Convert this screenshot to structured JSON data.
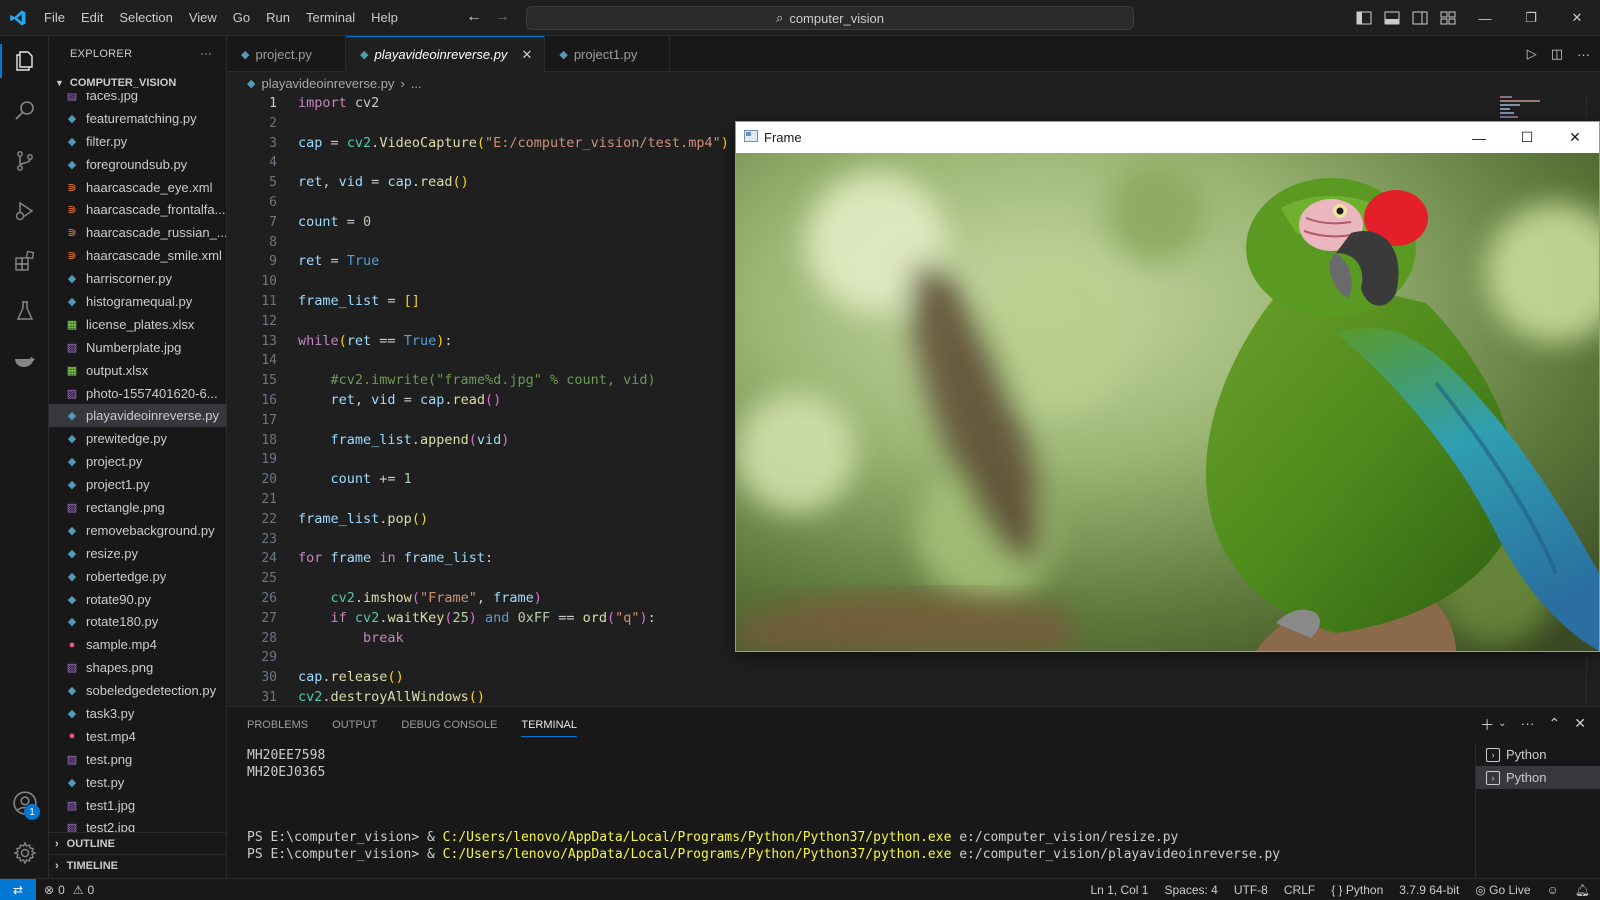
{
  "menu": [
    "File",
    "Edit",
    "Selection",
    "View",
    "Go",
    "Run",
    "Terminal",
    "Help"
  ],
  "search": {
    "text": "computer_vision"
  },
  "sidebar": {
    "title": "EXPLORER",
    "more": "···",
    "folder": "COMPUTER_VISION",
    "files": [
      {
        "name": "faces.jpg",
        "type": "img"
      },
      {
        "name": "featurematching.py",
        "type": "py"
      },
      {
        "name": "filter.py",
        "type": "py"
      },
      {
        "name": "foregroundsub.py",
        "type": "py"
      },
      {
        "name": "haarcascade_eye.xml",
        "type": "xml"
      },
      {
        "name": "haarcascade_frontalfa...",
        "type": "xml"
      },
      {
        "name": "haarcascade_russian_...",
        "type": "xml"
      },
      {
        "name": "haarcascade_smile.xml",
        "type": "xml"
      },
      {
        "name": "harriscorner.py",
        "type": "py"
      },
      {
        "name": "histogramequal.py",
        "type": "py"
      },
      {
        "name": "license_plates.xlsx",
        "type": "xlsx"
      },
      {
        "name": "Numberplate.jpg",
        "type": "img"
      },
      {
        "name": "output.xlsx",
        "type": "xlsx"
      },
      {
        "name": "photo-1557401620-6...",
        "type": "img"
      },
      {
        "name": "playavideoinreverse.py",
        "type": "py",
        "selected": true
      },
      {
        "name": "prewitedge.py",
        "type": "py"
      },
      {
        "name": "project.py",
        "type": "py"
      },
      {
        "name": "project1.py",
        "type": "py"
      },
      {
        "name": "rectangle.png",
        "type": "img"
      },
      {
        "name": "removebackground.py",
        "type": "py"
      },
      {
        "name": "resize.py",
        "type": "py"
      },
      {
        "name": "robertedge.py",
        "type": "py"
      },
      {
        "name": "rotate90.py",
        "type": "py"
      },
      {
        "name": "rotate180.py",
        "type": "py"
      },
      {
        "name": "sample.mp4",
        "type": "mp4"
      },
      {
        "name": "shapes.png",
        "type": "img"
      },
      {
        "name": "sobeledgedetection.py",
        "type": "py"
      },
      {
        "name": "task3.py",
        "type": "py"
      },
      {
        "name": "test.mp4",
        "type": "mp4"
      },
      {
        "name": "test.png",
        "type": "img"
      },
      {
        "name": "test.py",
        "type": "py"
      },
      {
        "name": "test1.jpg",
        "type": "img"
      },
      {
        "name": "test2.jpg",
        "type": "img"
      }
    ],
    "outline": "OUTLINE",
    "timeline": "TIMELINE"
  },
  "tabs": [
    {
      "label": "project.py",
      "active": false
    },
    {
      "label": "playavideoinreverse.py",
      "active": true
    },
    {
      "label": "project1.py",
      "active": false
    }
  ],
  "breadcrumb": {
    "file": "playavideoinreverse.py",
    "rest": "..."
  },
  "editor": {
    "current_line": 1,
    "lines": [
      [
        [
          "kw",
          "import"
        ],
        [
          "t",
          " cv2"
        ]
      ],
      [],
      [
        [
          "var",
          "cap"
        ],
        [
          "t",
          " = "
        ],
        [
          "mod",
          "cv2"
        ],
        [
          "t",
          "."
        ],
        [
          "fn",
          "VideoCapture"
        ],
        [
          "br",
          "("
        ],
        [
          "str",
          "\"E:/computer_vision/test.mp4\""
        ],
        [
          "br",
          ")"
        ]
      ],
      [],
      [
        [
          "var",
          "ret"
        ],
        [
          "t",
          ", "
        ],
        [
          "var",
          "vid"
        ],
        [
          "t",
          " = "
        ],
        [
          "var",
          "cap"
        ],
        [
          "t",
          "."
        ],
        [
          "fn",
          "read"
        ],
        [
          "br",
          "()"
        ]
      ],
      [],
      [
        [
          "var",
          "count"
        ],
        [
          "t",
          " = "
        ],
        [
          "num",
          "0"
        ]
      ],
      [],
      [
        [
          "var",
          "ret"
        ],
        [
          "t",
          " = "
        ],
        [
          "kw2",
          "True"
        ]
      ],
      [],
      [
        [
          "var",
          "frame_list"
        ],
        [
          "t",
          " = "
        ],
        [
          "br",
          "[]"
        ]
      ],
      [],
      [
        [
          "kw",
          "while"
        ],
        [
          "br",
          "("
        ],
        [
          "var",
          "ret"
        ],
        [
          "t",
          " == "
        ],
        [
          "kw2",
          "True"
        ],
        [
          "br",
          ")"
        ],
        [
          "t",
          ":"
        ]
      ],
      [],
      [
        [
          "t",
          "    "
        ],
        [
          "cmt",
          "#cv2.imwrite(\"frame%d.jpg\" % count, vid)"
        ]
      ],
      [
        [
          "t",
          "    "
        ],
        [
          "var",
          "ret"
        ],
        [
          "t",
          ", "
        ],
        [
          "var",
          "vid"
        ],
        [
          "t",
          " = "
        ],
        [
          "var",
          "cap"
        ],
        [
          "t",
          "."
        ],
        [
          "fn",
          "read"
        ],
        [
          "br2",
          "()"
        ]
      ],
      [],
      [
        [
          "t",
          "    "
        ],
        [
          "var",
          "frame_list"
        ],
        [
          "t",
          "."
        ],
        [
          "fn",
          "append"
        ],
        [
          "br2",
          "("
        ],
        [
          "var",
          "vid"
        ],
        [
          "br2",
          ")"
        ]
      ],
      [],
      [
        [
          "t",
          "    "
        ],
        [
          "var",
          "count"
        ],
        [
          "t",
          " += "
        ],
        [
          "num",
          "1"
        ]
      ],
      [],
      [
        [
          "var",
          "frame_list"
        ],
        [
          "t",
          "."
        ],
        [
          "fn",
          "pop"
        ],
        [
          "br",
          "()"
        ]
      ],
      [],
      [
        [
          "kw",
          "for"
        ],
        [
          "t",
          " "
        ],
        [
          "var",
          "frame"
        ],
        [
          "t",
          " "
        ],
        [
          "kw",
          "in"
        ],
        [
          "t",
          " "
        ],
        [
          "var",
          "frame_list"
        ],
        [
          "t",
          ":"
        ]
      ],
      [],
      [
        [
          "t",
          "    "
        ],
        [
          "mod",
          "cv2"
        ],
        [
          "t",
          "."
        ],
        [
          "fn",
          "imshow"
        ],
        [
          "br2",
          "("
        ],
        [
          "str",
          "\"Frame\""
        ],
        [
          "t",
          ", "
        ],
        [
          "var",
          "frame"
        ],
        [
          "br2",
          ")"
        ]
      ],
      [
        [
          "t",
          "    "
        ],
        [
          "kw",
          "if"
        ],
        [
          "t",
          " "
        ],
        [
          "mod",
          "cv2"
        ],
        [
          "t",
          "."
        ],
        [
          "fn",
          "waitKey"
        ],
        [
          "br2",
          "("
        ],
        [
          "num",
          "25"
        ],
        [
          "br2",
          ")"
        ],
        [
          "t",
          " "
        ],
        [
          "kw2",
          "and"
        ],
        [
          "t",
          " "
        ],
        [
          "num",
          "0xFF"
        ],
        [
          "t",
          " == "
        ],
        [
          "fn",
          "ord"
        ],
        [
          "br2",
          "("
        ],
        [
          "str",
          "\"q\""
        ],
        [
          "br2",
          ")"
        ],
        [
          "t",
          ":"
        ]
      ],
      [
        [
          "t",
          "        "
        ],
        [
          "kw",
          "break"
        ]
      ],
      [],
      [
        [
          "var",
          "cap"
        ],
        [
          "t",
          "."
        ],
        [
          "fn",
          "release"
        ],
        [
          "br",
          "()"
        ]
      ],
      [
        [
          "mod",
          "cv2"
        ],
        [
          "t",
          "."
        ],
        [
          "fn",
          "destroyAllWindows"
        ],
        [
          "br",
          "()"
        ]
      ]
    ]
  },
  "frame_window": {
    "title": "Frame"
  },
  "panel": {
    "tabs": [
      "PROBLEMS",
      "OUTPUT",
      "DEBUG CONSOLE",
      "TERMINAL"
    ],
    "active_tab": "TERMINAL",
    "output_lines": [
      "MH20EE7598",
      "MH20EJ0365"
    ],
    "commands": [
      {
        "prompt": "PS E:\\computer_vision> & ",
        "exe": "C:/Users/lenovo/AppData/Local/Programs/Python/Python37/python.exe",
        "arg": " e:/computer_vision/resize.py"
      },
      {
        "prompt": "PS E:\\computer_vision> & ",
        "exe": "C:/Users/lenovo/AppData/Local/Programs/Python/Python37/python.exe",
        "arg": " e:/computer_vision/playavideoinreverse.py"
      }
    ],
    "terminals": [
      "Python",
      "Python"
    ]
  },
  "status": {
    "errors": "0",
    "warnings": "0",
    "position": "Ln 1, Col 1",
    "spaces": "Spaces: 4",
    "encoding": "UTF-8",
    "eol": "CRLF",
    "language": "Python",
    "interpreter": "3.7.9 64-bit",
    "golive": "Go Live"
  },
  "accounts_badge": "1",
  "colors": {
    "accent": "#0078d4",
    "bg": "#1f1f1f",
    "sidebar": "#181818"
  }
}
